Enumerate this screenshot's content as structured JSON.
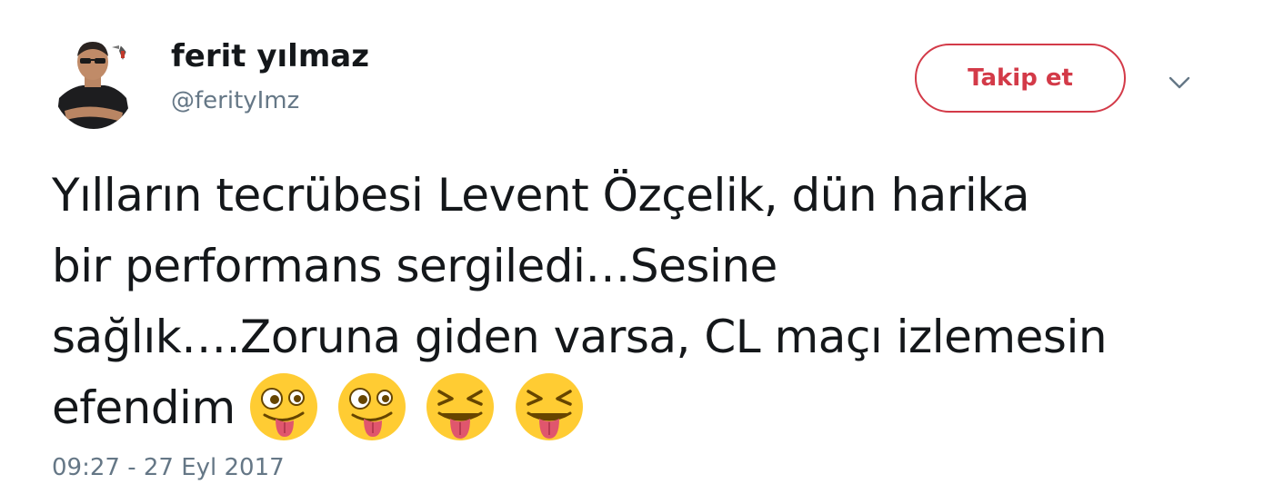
{
  "tweet": {
    "author": {
      "name": "ferit yılmaz",
      "handle": "@ferityImz"
    },
    "follow_button_label": "Takip et",
    "text_lines": [
      "Yılların tecrübesi Levent Özçelik, dün harika",
      "bir performans sergiledi…Sesine",
      "sağlık….Zoruna giden varsa, CL maçı izlemesin",
      "efendim"
    ],
    "emojis": [
      "winking-face-with-tongue-icon",
      "winking-face-with-tongue-icon",
      "squinting-face-with-tongue-icon",
      "squinting-face-with-tongue-icon"
    ],
    "timestamp": "09:27 - 27 Eyl 2017"
  },
  "colors": {
    "accent": "#d33a48",
    "text": "#14171a",
    "muted": "#657786",
    "emoji_yellow": "#ffcc33",
    "tongue": "#e0566d"
  }
}
